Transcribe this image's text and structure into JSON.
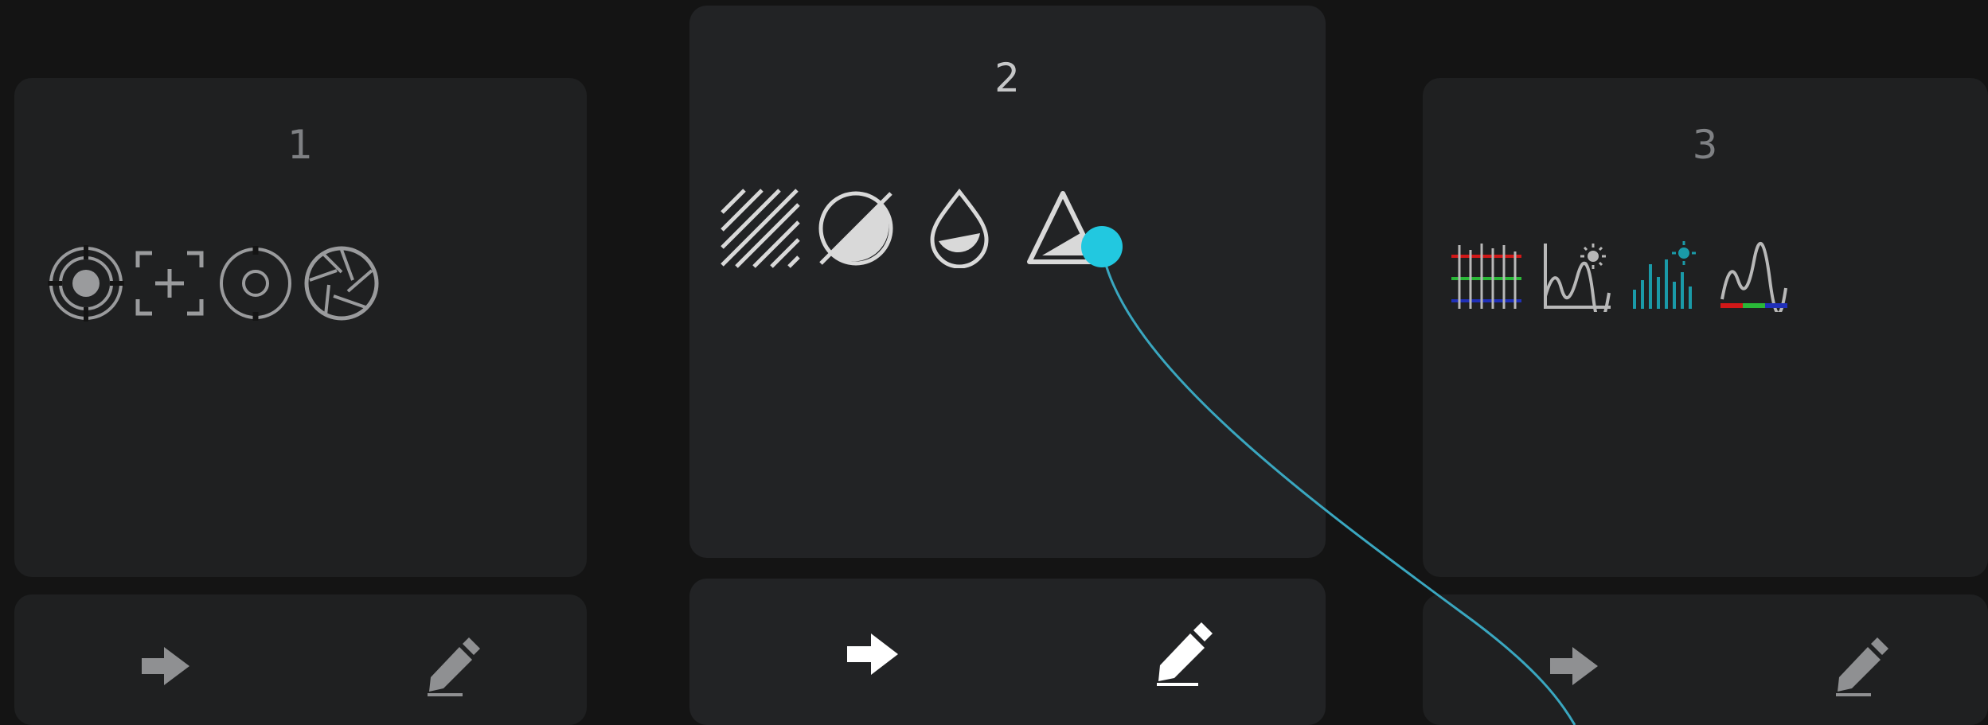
{
  "cards": [
    {
      "number": "1",
      "icons": [
        "target-rings-icon",
        "focus-plus-icon",
        "ring-dot-icon",
        "aperture-icon"
      ],
      "actions": [
        "forward-arrow-icon",
        "edit-pencil-icon"
      ]
    },
    {
      "number": "2",
      "icons": [
        "hatch-pattern-icon",
        "half-moon-slash-icon",
        "water-drop-icon",
        "triangle-exposure-icon"
      ],
      "actions": [
        "forward-arrow-icon",
        "edit-pencil-icon"
      ]
    },
    {
      "number": "3",
      "icons": [
        "rgb-levels-icon",
        "curve-sun-icon",
        "histogram-sun-icon",
        "rgb-waveform-icon"
      ],
      "actions": [
        "forward-arrow-icon",
        "edit-pencil-icon"
      ]
    }
  ],
  "colors": {
    "background": "#141414",
    "card": "#1f2021",
    "connector": "#3aa7c0",
    "connector_dot": "#22c8e0",
    "icon_dim": "#9a9b9d",
    "icon_active": "#e6e6e6",
    "teal": "#1a9aa8",
    "red": "#d01818",
    "green": "#2ab838",
    "blue": "#2030b8"
  }
}
